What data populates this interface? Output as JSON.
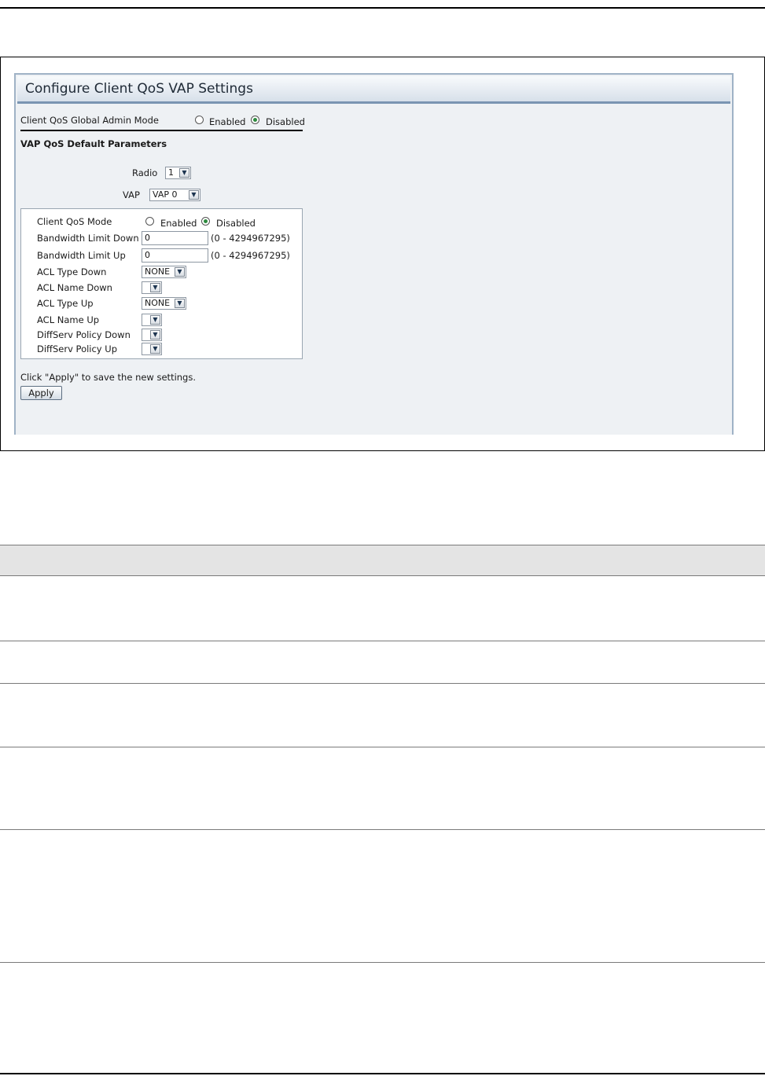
{
  "panel": {
    "title": "Configure Client QoS VAP Settings"
  },
  "global_mode": {
    "label": "Client QoS Global Admin Mode",
    "enabled_label": "Enabled",
    "disabled_label": "Disabled",
    "selected": "Disabled"
  },
  "section_title": "VAP QoS Default Parameters",
  "radio": {
    "label": "Radio",
    "value": "1"
  },
  "vap": {
    "label": "VAP",
    "value": "VAP 0"
  },
  "client_qos_mode": {
    "label": "Client QoS Mode",
    "enabled_label": "Enabled",
    "disabled_label": "Disabled",
    "selected": "Disabled"
  },
  "bandwidth_down": {
    "label": "Bandwidth Limit Down",
    "value": "0",
    "range": "(0 - 4294967295)"
  },
  "bandwidth_up": {
    "label": "Bandwidth Limit Up",
    "value": "0",
    "range": "(0 - 4294967295)"
  },
  "acl_type_down": {
    "label": "ACL Type Down",
    "value": "NONE"
  },
  "acl_name_down": {
    "label": "ACL Name Down",
    "value": ""
  },
  "acl_type_up": {
    "label": "ACL Type Up",
    "value": "NONE"
  },
  "acl_name_up": {
    "label": "ACL Name Up",
    "value": ""
  },
  "diffserv_down": {
    "label": "DiffServ Policy Down",
    "value": ""
  },
  "diffserv_up": {
    "label": "DiffServ Policy Up",
    "value": ""
  },
  "apply_hint": "Click \"Apply\" to save the new settings.",
  "apply_button": "Apply",
  "icons": {
    "dropdown": "chevron-down-icon",
    "radio": "radio-button-icon"
  }
}
